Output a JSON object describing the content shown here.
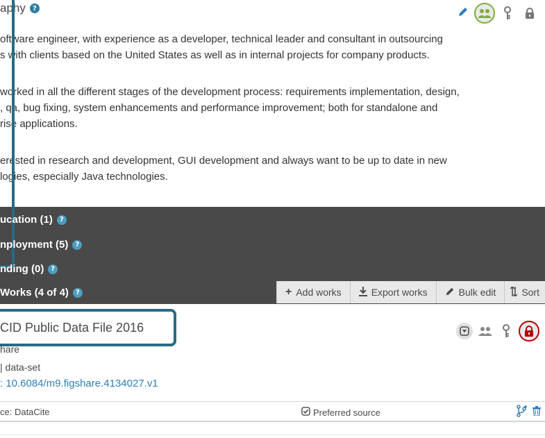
{
  "biography": {
    "title": "aphy",
    "paragraphs": [
      [
        "oftware engineer, with experience as a developer, technical leader and consultant in outsourcing",
        "s with clients based on the United States as well as in internal projects for company products."
      ],
      [
        "worked in all the different stages of the development process: requirements implementation, design,",
        ", qa, bug fixing, system enhancements and performance improvement; both for standalone and",
        "rise applications."
      ],
      [
        "erested in research and development, GUI development and always want to be up to date in new",
        "logies, especially Java technologies."
      ]
    ]
  },
  "sections": {
    "education": "ucation (1)",
    "employment": "nployment (5)",
    "funding": "nding (0)",
    "works": "Works (4 of 4)"
  },
  "toolbar": {
    "add_works": "Add works",
    "export_works": "Export works",
    "bulk_edit": "Bulk edit",
    "sort": "Sort"
  },
  "work": {
    "title": "CID Public Data File 2016",
    "journal": "hare",
    "type": "| data-set",
    "doi": ": 10.6084/m9.figshare.4134027.v1",
    "source": "ce: DataCite",
    "preferred": "Preferred source"
  },
  "colors": {
    "accent_teal": "#2a6a82",
    "dark_band": "#494949",
    "visibility_green": "#7fad3b",
    "visibility_red": "#b30000",
    "link_blue": "#2e7fb6"
  }
}
